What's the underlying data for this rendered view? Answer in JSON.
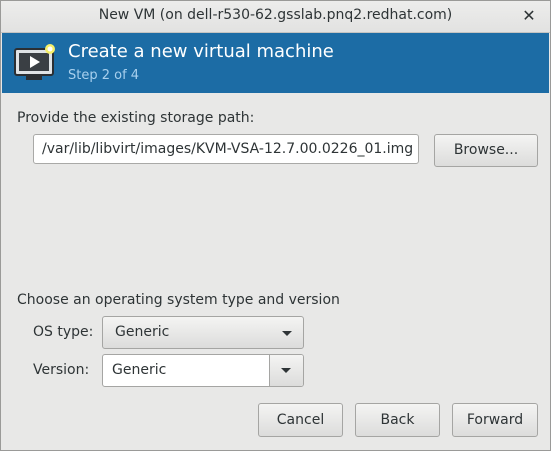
{
  "window": {
    "title": "New VM (on dell-r530-62.gsslab.pnq2.redhat.com)",
    "close_glyph": "✕"
  },
  "banner": {
    "icon": "vm-monitor-icon",
    "title": "Create a new virtual machine",
    "step": "Step 2 of 4",
    "color": "#1c6ca5"
  },
  "storage": {
    "label": "Provide the existing storage path:",
    "path_value": "/var/lib/libvirt/images/KVM-VSA-12.7.00.0226_01.img",
    "browse_label": "Browse..."
  },
  "os": {
    "section_label": "Choose an operating system type and version",
    "type_label": "OS type:",
    "type_value": "Generic",
    "version_label": "Version:",
    "version_value": "Generic"
  },
  "actions": {
    "cancel": "Cancel",
    "back": "Back",
    "forward": "Forward"
  }
}
